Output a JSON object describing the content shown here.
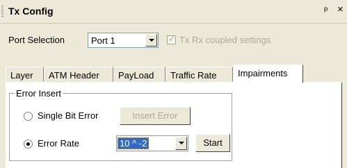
{
  "window": {
    "title": "Tx Config",
    "pin_glyph": "、",
    "close_glyph": "×"
  },
  "port": {
    "label": "Port Selection",
    "selected": "Port 1",
    "coupled_label": "Tx Rx coupled settings",
    "coupled_checked": true
  },
  "tabs": [
    {
      "label": "Layer"
    },
    {
      "label": "ATM Header"
    },
    {
      "label": "PayLoad"
    },
    {
      "label": "Traffic Rate"
    },
    {
      "label": "Impairments"
    }
  ],
  "active_tab": "Impairments",
  "error_insert": {
    "group_title": "Error Insert",
    "single_bit_label": "Single Bit Error",
    "insert_button": "Insert Error",
    "error_rate_label": "Error Rate",
    "rate_value": "10 ^ -2",
    "start_button": "Start",
    "selected_option": "Error Rate"
  }
}
